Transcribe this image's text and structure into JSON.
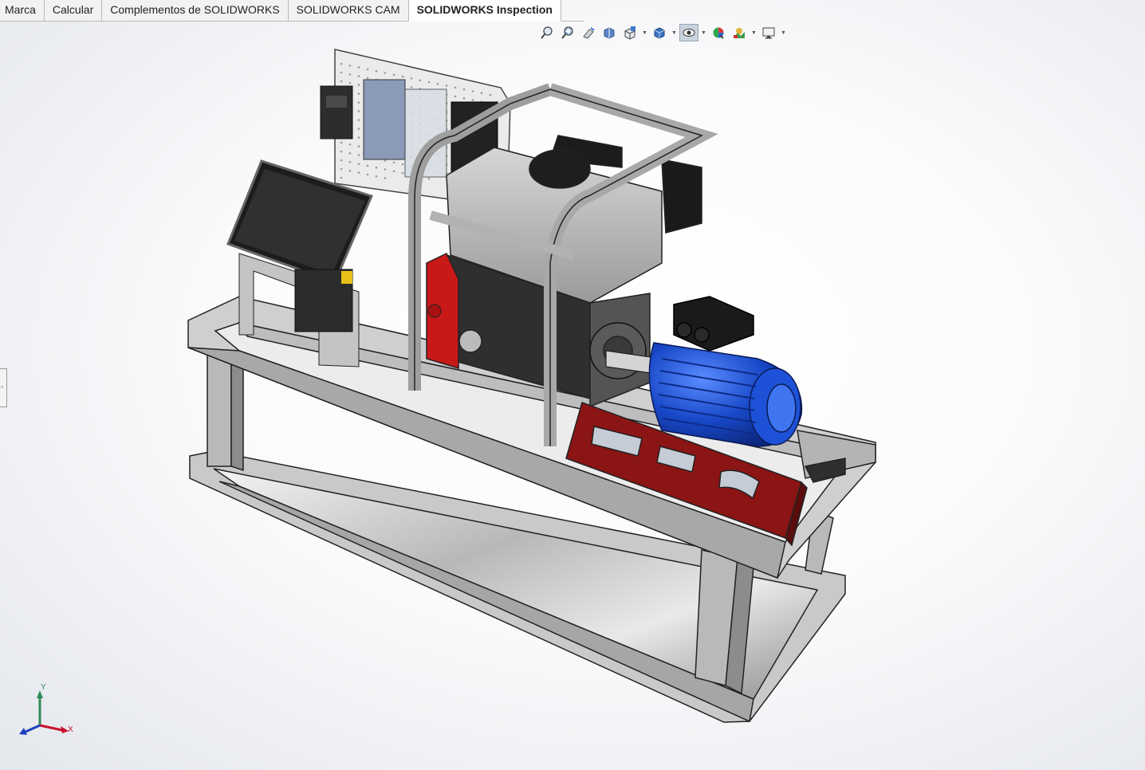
{
  "tabs": [
    {
      "label": "Marca",
      "active": false
    },
    {
      "label": "Calcular",
      "active": false
    },
    {
      "label": "Complementos de SOLIDWORKS",
      "active": false
    },
    {
      "label": "SOLIDWORKS CAM",
      "active": false
    },
    {
      "label": "SOLIDWORKS Inspection",
      "active": true
    }
  ],
  "heads_up_toolbar": {
    "icons": [
      "zoom-to-fit-icon",
      "zoom-to-area-icon",
      "previous-view-icon",
      "section-view-icon",
      "view-orientation-icon",
      "display-style-icon",
      "hide-show-items-icon",
      "edit-appearance-icon",
      "apply-scene-icon",
      "view-settings-icon"
    ]
  },
  "triad": {
    "y_label": "Y",
    "x_label": "X",
    "x_color": "#c8102e",
    "y_color": "#2e8b57",
    "z_color": "#1e3fbf"
  },
  "colors": {
    "frame": "#c2c2c4",
    "frame_dark": "#8a8a8c",
    "motor": "#1848c8",
    "red_panel": "#8b1414",
    "engine_red": "#c81818"
  }
}
